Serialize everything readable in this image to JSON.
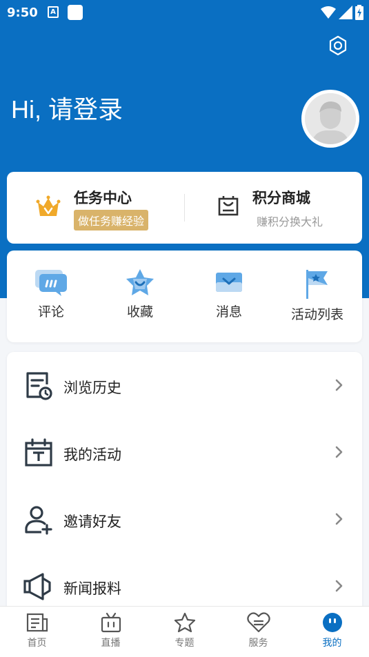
{
  "status_bar": {
    "time": "9:50",
    "a_glyph": "A"
  },
  "header": {
    "greeting": "Hi, 请登录",
    "settings_icon": "gear-hexagon-icon",
    "bg_color": "#0a6fc2"
  },
  "task_card": {
    "task_center": {
      "title": "任务中心",
      "badge": "做任务赚经验"
    },
    "points_mall": {
      "title": "积分商城",
      "subtitle": "赚积分换大礼"
    }
  },
  "quick_actions": [
    {
      "label": "评论",
      "icon": "comment-icon"
    },
    {
      "label": "收藏",
      "icon": "favorite-star-icon"
    },
    {
      "label": "消息",
      "icon": "message-envelope-icon"
    },
    {
      "label": "活动列表",
      "icon": "flag-icon"
    }
  ],
  "menu": [
    {
      "label": "浏览历史",
      "icon": "history-icon"
    },
    {
      "label": "我的活动",
      "icon": "calendar-icon"
    },
    {
      "label": "邀请好友",
      "icon": "invite-user-icon"
    },
    {
      "label": "新闻报料",
      "icon": "megaphone-icon"
    }
  ],
  "bottom_nav": [
    {
      "label": "首页",
      "icon": "home-news-icon"
    },
    {
      "label": "直播",
      "icon": "tv-icon"
    },
    {
      "label": "专题",
      "icon": "star-icon"
    },
    {
      "label": "服务",
      "icon": "service-heart-icon"
    },
    {
      "label": "我的",
      "icon": "profile-face-icon",
      "active": true
    }
  ]
}
